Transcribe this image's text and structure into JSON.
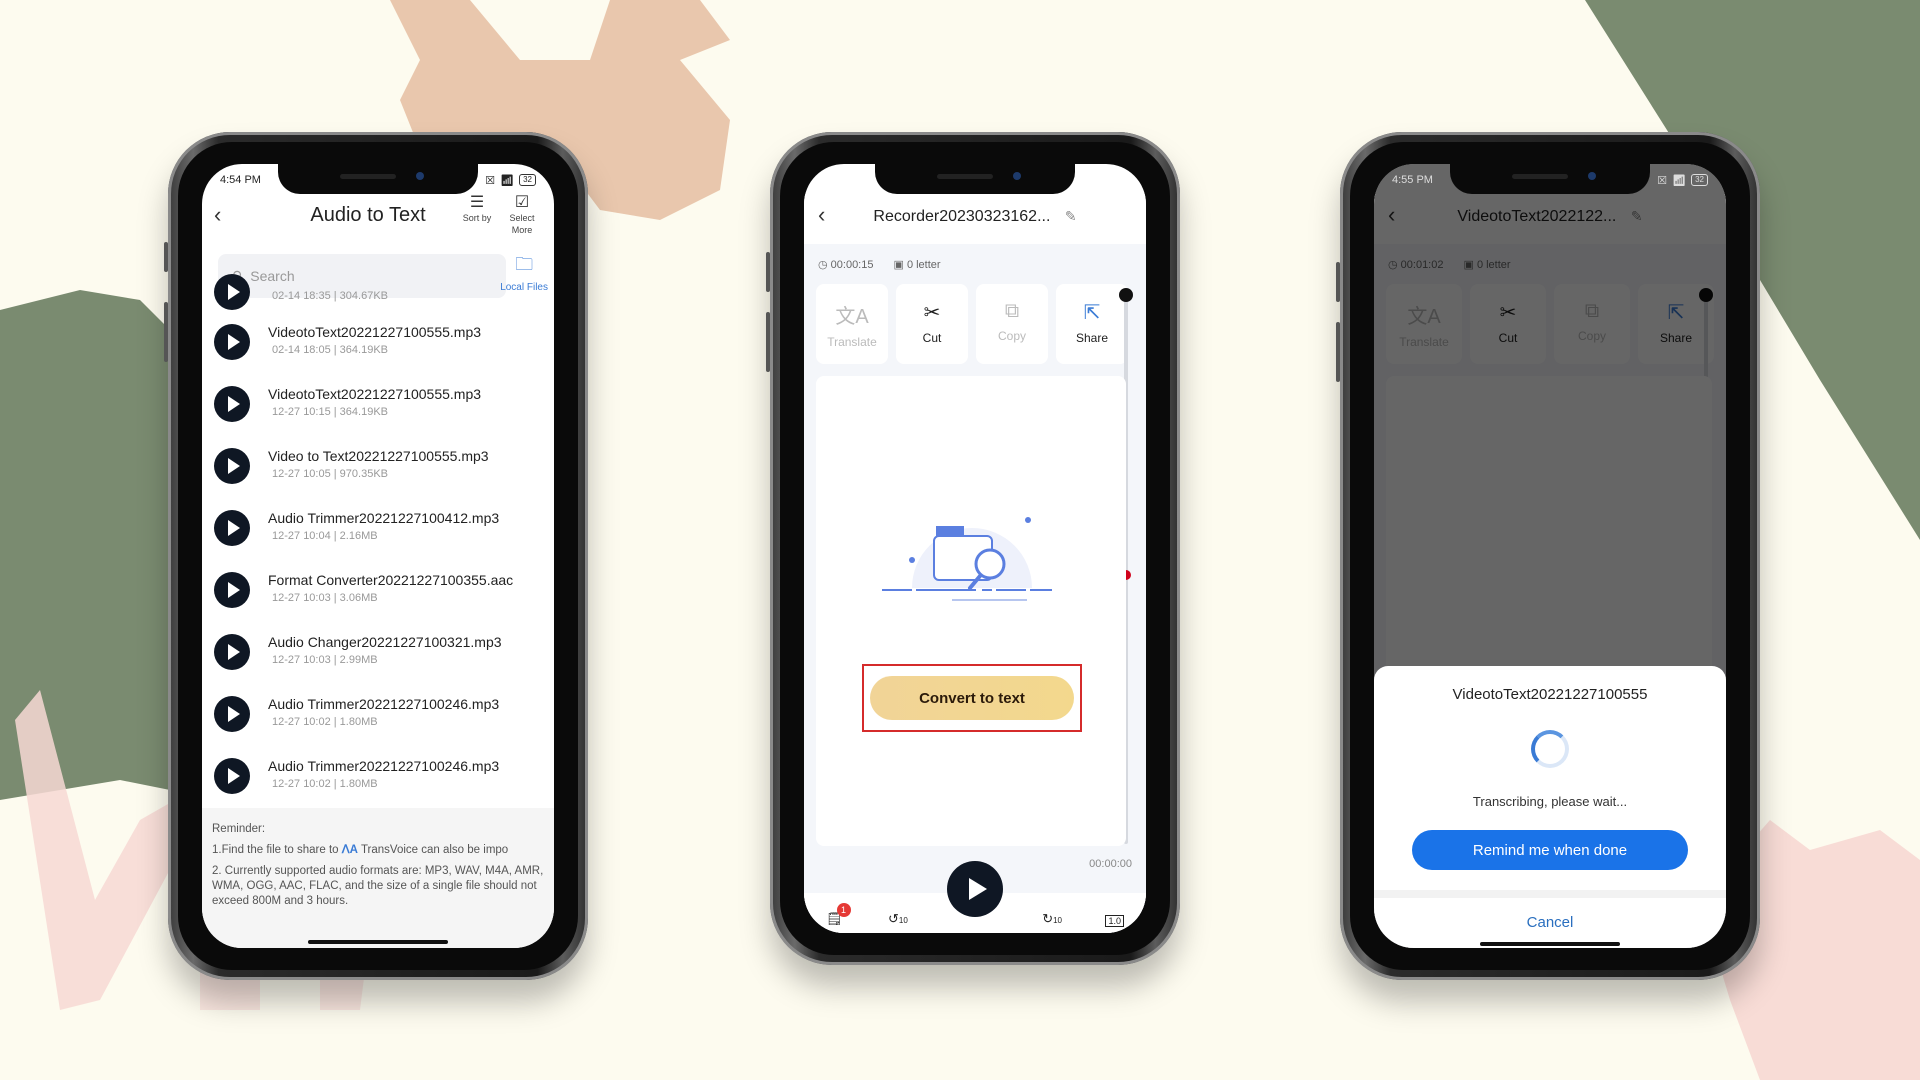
{
  "colors": {
    "background": "#fdfbef",
    "green_shape": "#7a8b70",
    "peach_shape": "#e9c7ad",
    "pink_shape": "#f7d8d3",
    "accent_blue": "#1a73e8",
    "convert_button": "#f1d497",
    "highlight_box": "#d52b2b",
    "marker_red": "#d0021b"
  },
  "phone1": {
    "status": {
      "time": "4:54 PM",
      "battery": "32"
    },
    "header": {
      "title": "Audio to Text",
      "sort_label": "Sort by",
      "select_label": "Select More"
    },
    "search": {
      "placeholder": "Search"
    },
    "local_files_label": "Local Files",
    "files": [
      {
        "name": "",
        "meta": "02-14 18:35 | 304.67KB"
      },
      {
        "name": "VideotoText20221227100555.mp3",
        "meta": "02-14 18:05 | 364.19KB"
      },
      {
        "name": "VideotoText20221227100555.mp3",
        "meta": "12-27 10:15 | 364.19KB"
      },
      {
        "name": "Video to Text20221227100555.mp3",
        "meta": "12-27 10:05 | 970.35KB"
      },
      {
        "name": "Audio Trimmer20221227100412.mp3",
        "meta": "12-27 10:04 | 2.16MB"
      },
      {
        "name": "Format Converter20221227100355.aac",
        "meta": "12-27 10:03 | 3.06MB"
      },
      {
        "name": "Audio Changer20221227100321.mp3",
        "meta": "12-27 10:03 | 2.99MB"
      },
      {
        "name": "Audio Trimmer20221227100246.mp3",
        "meta": "12-27 10:02 | 1.80MB"
      },
      {
        "name": "Audio Trimmer20221227100246.mp3",
        "meta": "12-27 10:02 | 1.80MB"
      }
    ],
    "reminder": {
      "heading": "Reminder:",
      "line1_prefix": "1.Find the file to share to",
      "app_name": "TransVoice can also be impo",
      "line2": "2. Currently supported audio formats are: MP3, WAV, M4A, AMR, WMA, OGG, AAC, FLAC, and the size of a single file should not exceed 800M and 3 hours."
    }
  },
  "phone2": {
    "title": "Recorder20230323162...",
    "duration": "00:00:15",
    "letters": "0 letter",
    "tools": [
      {
        "label": "Translate",
        "icon": "translate-icon",
        "enabled": false
      },
      {
        "label": "Cut",
        "icon": "scissors-icon",
        "enabled": true
      },
      {
        "label": "Copy",
        "icon": "copy-icon",
        "enabled": false
      },
      {
        "label": "Share",
        "icon": "share-icon",
        "enabled": true
      }
    ],
    "convert_label": "Convert to text",
    "timecode": "00:00:00",
    "badge_count": "1",
    "rewind_label": "10",
    "forward_label": "10",
    "speed_label": "1.0"
  },
  "phone3": {
    "status": {
      "time": "4:55 PM",
      "battery": "32"
    },
    "title": "VideotoText2022122...",
    "duration": "00:01:02",
    "letters": "0 letter",
    "tools": [
      {
        "label": "Translate",
        "icon": "translate-icon",
        "enabled": false
      },
      {
        "label": "Cut",
        "icon": "scissors-icon",
        "enabled": true
      },
      {
        "label": "Copy",
        "icon": "copy-icon",
        "enabled": false
      },
      {
        "label": "Share",
        "icon": "share-icon",
        "enabled": true
      }
    ],
    "dialog": {
      "file_name": "VideotoText20221227100555",
      "message": "Transcribing, please wait...",
      "remind_label": "Remind me when done",
      "cancel_label": "Cancel"
    }
  }
}
